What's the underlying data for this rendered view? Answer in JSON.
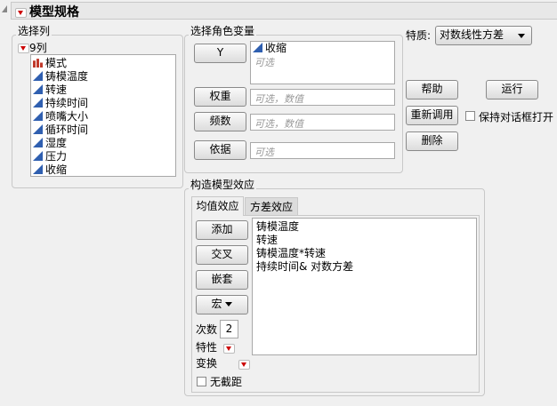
{
  "header": {
    "title": "模型规格"
  },
  "select_columns": {
    "label": "选择列",
    "count_label": "9列",
    "columns": [
      {
        "name": "模式",
        "type": "nominal"
      },
      {
        "name": "铸模温度",
        "type": "continuous"
      },
      {
        "name": "转速",
        "type": "continuous"
      },
      {
        "name": "持续时间",
        "type": "continuous"
      },
      {
        "name": "喷嘴大小",
        "type": "continuous"
      },
      {
        "name": "循环时间",
        "type": "continuous"
      },
      {
        "name": "湿度",
        "type": "continuous"
      },
      {
        "name": "压力",
        "type": "continuous"
      },
      {
        "name": "收缩",
        "type": "continuous"
      }
    ]
  },
  "roles": {
    "label": "选择角色变量",
    "y_button": "Y",
    "y_value": "收缩",
    "y_placeholder": "可选",
    "weight_button": "权重",
    "weight_placeholder": "可选，数值",
    "freq_button": "频数",
    "freq_placeholder": "可选，数值",
    "by_button": "依据",
    "by_placeholder": "可选"
  },
  "personality": {
    "label": "特质:",
    "value": "对数线性方差"
  },
  "actions": {
    "help": "帮助",
    "run": "运行",
    "recall": "重新调用",
    "keep_open": "保持对话框打开",
    "remove": "删除"
  },
  "effects": {
    "label": "构造模型效应",
    "tabs": [
      "均值效应",
      "方差效应"
    ],
    "add": "添加",
    "cross": "交叉",
    "nest": "嵌套",
    "macros": "宏",
    "degree_label": "次数",
    "degree_value": "2",
    "attributes_label": "特性",
    "transform_label": "变换",
    "no_intercept": "无截距",
    "items": [
      "铸模温度",
      "转速",
      "铸模温度*转速",
      "持续时间& 对数方差"
    ]
  }
}
